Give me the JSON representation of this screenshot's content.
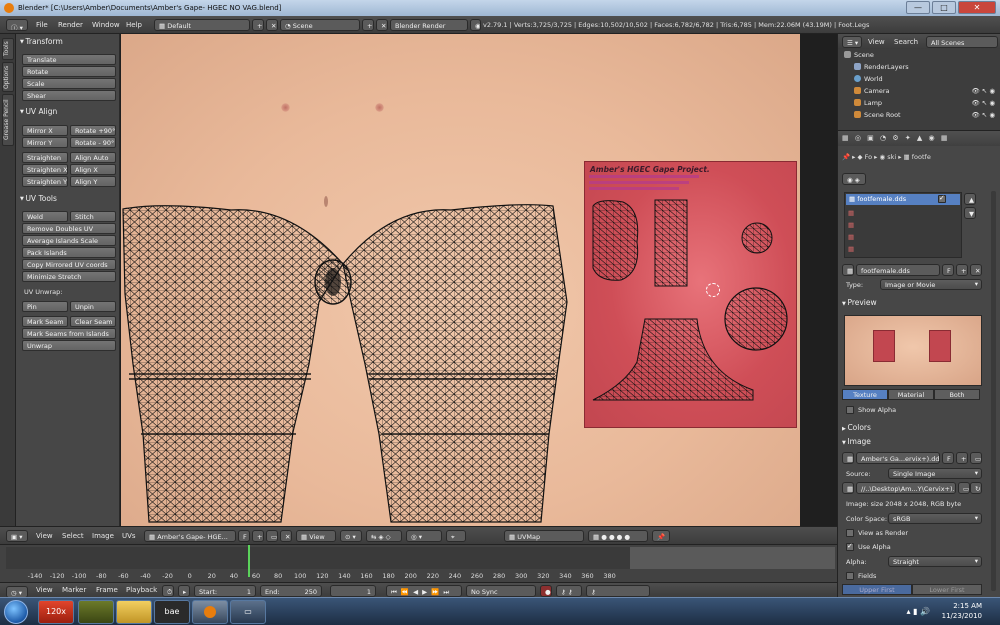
{
  "window": {
    "title": "Blender* [C:\\Users\\Amber\\Documents\\Amber's Gape- HGEC NO VAG.blend]",
    "min": "—",
    "max": "□",
    "close": "✕"
  },
  "info": {
    "menus": [
      "File",
      "Render",
      "Window",
      "Help"
    ],
    "screen_layout": "Default",
    "scene": "Scene",
    "engine": "Blender Render",
    "stats": "v2.79.1 | Verts:3,725/3,725 | Edges:10,502/10,502 | Faces:6,782/6,782 | Tris:6,785 | Mem:22.06M (43.19M) | Foot.Legs"
  },
  "shelf": {
    "tabs": [
      "Tools",
      "Options",
      "Grease Pencil"
    ],
    "transform": {
      "title": "Transform",
      "buttons": [
        "Translate",
        "Rotate",
        "Scale",
        "Shear"
      ]
    },
    "uv_align": {
      "title": "UV Align",
      "buttons": [
        "Mirror X",
        "Rotate +90°",
        "Mirror Y",
        "Rotate - 90°",
        "Straighten",
        "Align Auto",
        "Straighten X",
        "Align X",
        "Straighten Y",
        "Align Y"
      ]
    },
    "uv_tools": {
      "title": "UV Tools",
      "buttons": [
        "Weld",
        "Stitch",
        "Remove Doubles UV",
        "Average Islands Scale",
        "Pack Islands",
        "Copy Mirrored UV coords",
        "Minimize Stretch"
      ],
      "unwrap_label": "UV Unwrap:",
      "unwrap_buttons": [
        "Pin",
        "Unpin",
        "Mark Seam",
        "Clear Seam",
        "Mark Seams from Islands",
        "Unwrap"
      ]
    }
  },
  "texture_panel": {
    "title": "Amber's HGEC Gape Project."
  },
  "uv_header": {
    "menus": [
      "View",
      "Select",
      "Image",
      "UVs"
    ],
    "image_name": "Amber's Gape- HGE...",
    "image_flag": "F",
    "view_mode": "View",
    "uv_map": "UVMap"
  },
  "timeline": {
    "ticks": [
      "-140",
      "-120",
      "-100",
      "-80",
      "-60",
      "-40",
      "-20",
      "0",
      "20",
      "40",
      "60",
      "80",
      "100",
      "120",
      "140",
      "160",
      "180",
      "200",
      "220",
      "240",
      "260",
      "280",
      "300",
      "320",
      "340",
      "360",
      "380"
    ],
    "menus": [
      "View",
      "Marker",
      "Frame",
      "Playback"
    ],
    "start_label": "Start:",
    "start": "1",
    "end_label": "End:",
    "end": "250",
    "current": "1",
    "sync": "No Sync",
    "current_frame_value": 1
  },
  "outliner": {
    "menus": [
      "View",
      "Search"
    ],
    "filter": "All Scenes",
    "rows": [
      "Scene",
      "RenderLayers",
      "World",
      "Camera",
      "Lamp",
      "Scene Root"
    ]
  },
  "properties": {
    "breadcrumb": [
      "Fo",
      "ski",
      "footfe"
    ],
    "image_list": [
      "footfemale.dds"
    ],
    "texture_name": "footfemale.dds",
    "texture_flag": "F",
    "type_label": "Type:",
    "type_value": "Image or Movie",
    "preview_title": "Preview",
    "preview_tabs": [
      "Texture",
      "Material",
      "Both"
    ],
    "show_alpha": "Show Alpha",
    "colors_title": "Colors",
    "image_title": "Image",
    "image_name": "Amber's Ga...ervix+).dds",
    "image_flag": "F",
    "source_label": "Source:",
    "source_value": "Single Image",
    "filepath": "//..\\Desktop\\Am...Y\\Cervix+).dds",
    "image_info": "Image: size 2048 x 2048, RGB byte",
    "colorspace_label": "Color Space:",
    "colorspace_value": "sRGB",
    "view_as_render": "View as Render",
    "use_alpha": "Use Alpha",
    "alpha_label": "Alpha:",
    "alpha_value": "Straight",
    "fields": "Fields",
    "field_order": [
      "Upper First",
      "Lower First"
    ]
  },
  "taskbar": {
    "apps": [
      "",
      "120x",
      "",
      "",
      "bae",
      "",
      ""
    ],
    "time": "2:15 AM",
    "date": "11/23/2010"
  },
  "colors": {
    "accent": "#5680c2",
    "blender_orange": "#e87d0d",
    "texture_red": "#c94b54",
    "skin": "#edbf9f"
  }
}
